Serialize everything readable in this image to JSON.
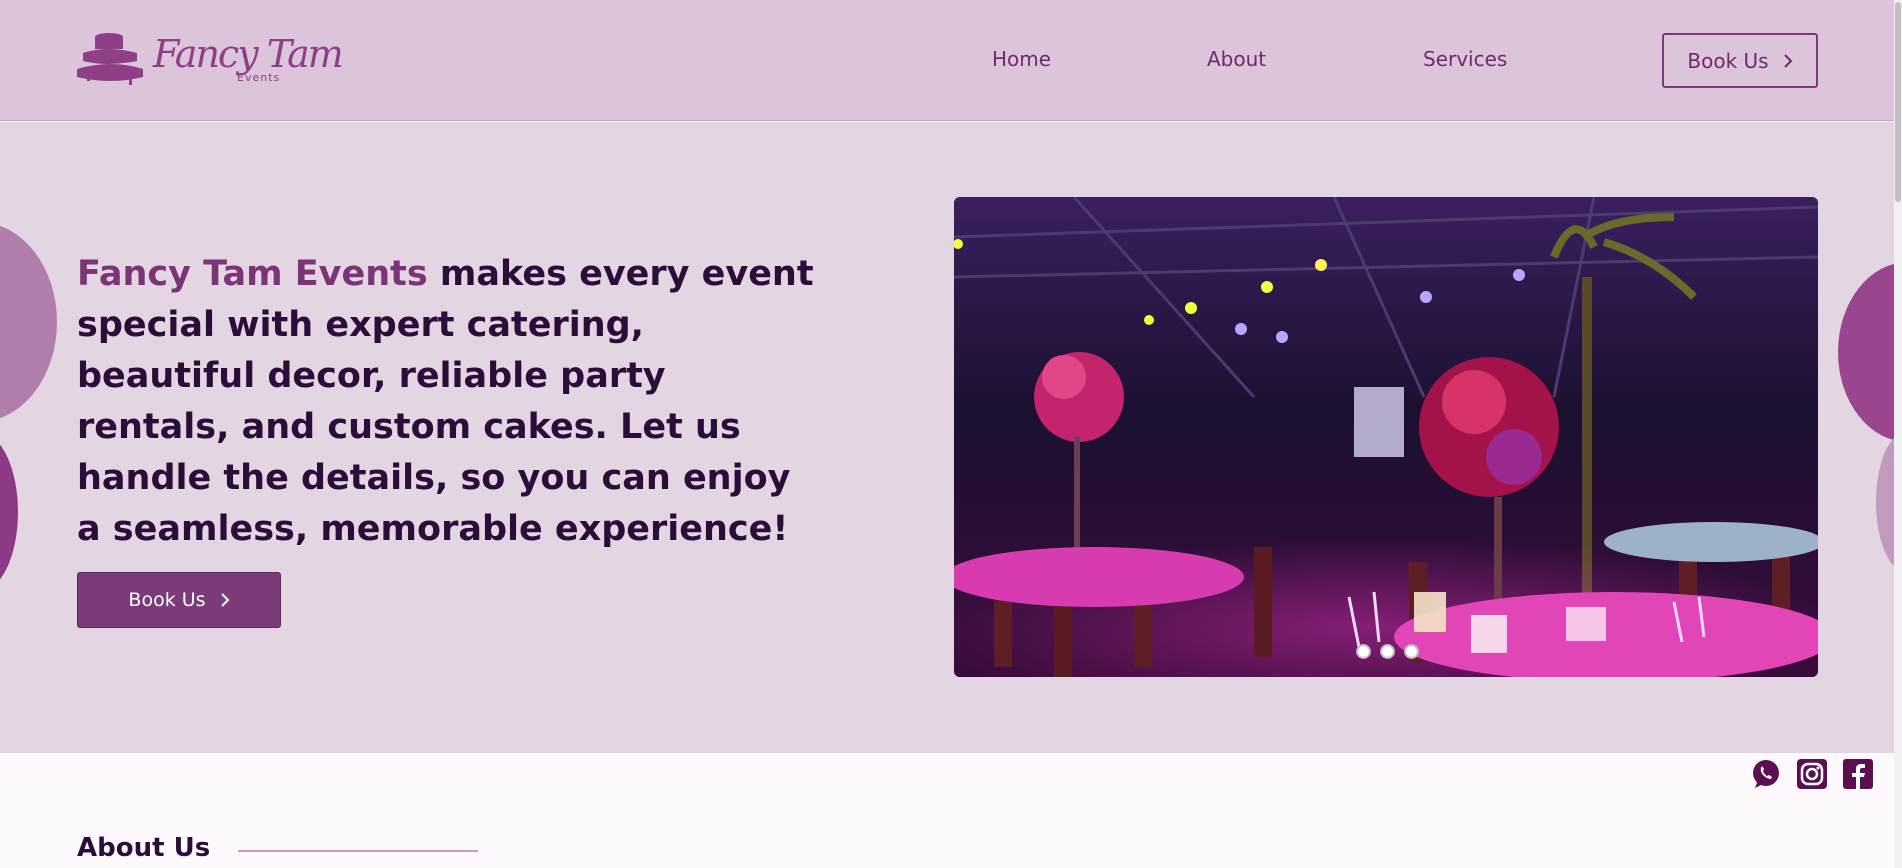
{
  "brand": {
    "logo_script": "Fancy Tam",
    "logo_sub": "Events"
  },
  "nav": {
    "home": "Home",
    "about": "About",
    "services": "Services",
    "book": "Book Us"
  },
  "hero": {
    "brand_text": "Fancy Tam Events",
    "body_text": " makes every event special with expert catering, beautiful decor, reliable party rentals, and custom cakes. Let us handle the details, so you can enjoy a seamless, memorable experience!",
    "button": "Book Us"
  },
  "carousel": {
    "slide_count": 3,
    "active_index": 0
  },
  "social": {
    "icons": [
      "whatsapp-icon",
      "instagram-icon",
      "facebook-icon"
    ]
  },
  "about": {
    "title": "About Us"
  },
  "colors": {
    "header_bg": "#dcc5da",
    "hero_bg": "#e4d5e3",
    "accent": "#7d3a78",
    "dark_text": "#2a0d38"
  }
}
